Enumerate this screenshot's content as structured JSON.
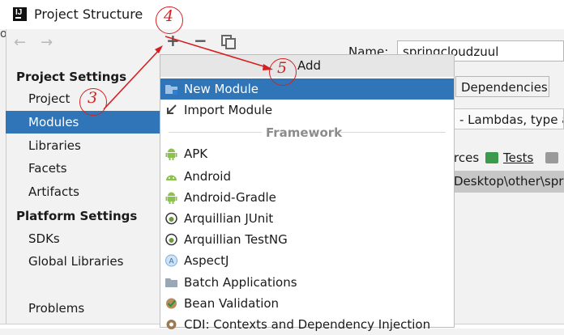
{
  "window": {
    "title": "Project Structure",
    "background_fragment": "ou"
  },
  "nav": {
    "back": "←",
    "forward": "→",
    "section_project_settings": "Project Settings",
    "items_project": [
      {
        "label": "Project",
        "selected": false
      },
      {
        "label": "Modules",
        "selected": true
      },
      {
        "label": "Libraries",
        "selected": false
      },
      {
        "label": "Facets",
        "selected": false
      },
      {
        "label": "Artifacts",
        "selected": false
      }
    ],
    "section_platform_settings": "Platform Settings",
    "items_platform": [
      {
        "label": "SDKs"
      },
      {
        "label": "Global Libraries"
      }
    ],
    "problems": "Problems"
  },
  "toolbar": {
    "add": "+",
    "remove": "−"
  },
  "right_panel": {
    "name_label": "Name:",
    "name_value": "springcloudzuul",
    "tab_dependencies": "Dependencies",
    "language_level": "- Lambdas, type an",
    "sources_fragment": "rces",
    "tests_label": "Tests",
    "content_root": "Desktop\\other\\spri"
  },
  "popup": {
    "title": "Add",
    "items_top": [
      {
        "label": "New Module",
        "icon": "module-folder-icon",
        "selected": true
      },
      {
        "label": "Import Module",
        "icon": "import-arrow-icon",
        "selected": false
      }
    ],
    "framework_header": "Framework",
    "frameworks": [
      {
        "label": "APK",
        "icon": "android-icon"
      },
      {
        "label": "Android",
        "icon": "android-head-icon"
      },
      {
        "label": "Android-Gradle",
        "icon": "android-icon"
      },
      {
        "label": "Arquillian JUnit",
        "icon": "arquillian-icon"
      },
      {
        "label": "Arquillian TestNG",
        "icon": "arquillian-icon"
      },
      {
        "label": "AspectJ",
        "icon": "aspectj-icon"
      },
      {
        "label": "Batch Applications",
        "icon": "folder-icon"
      },
      {
        "label": "Bean Validation",
        "icon": "bean-validation-icon"
      },
      {
        "label": "CDI: Contexts and Dependency Injection",
        "icon": "cdi-icon"
      }
    ]
  },
  "annotations": {
    "a3": "3",
    "a4": "4",
    "a5": "5"
  },
  "colors": {
    "selection": "#2f75b8",
    "annotation": "#d62020"
  }
}
